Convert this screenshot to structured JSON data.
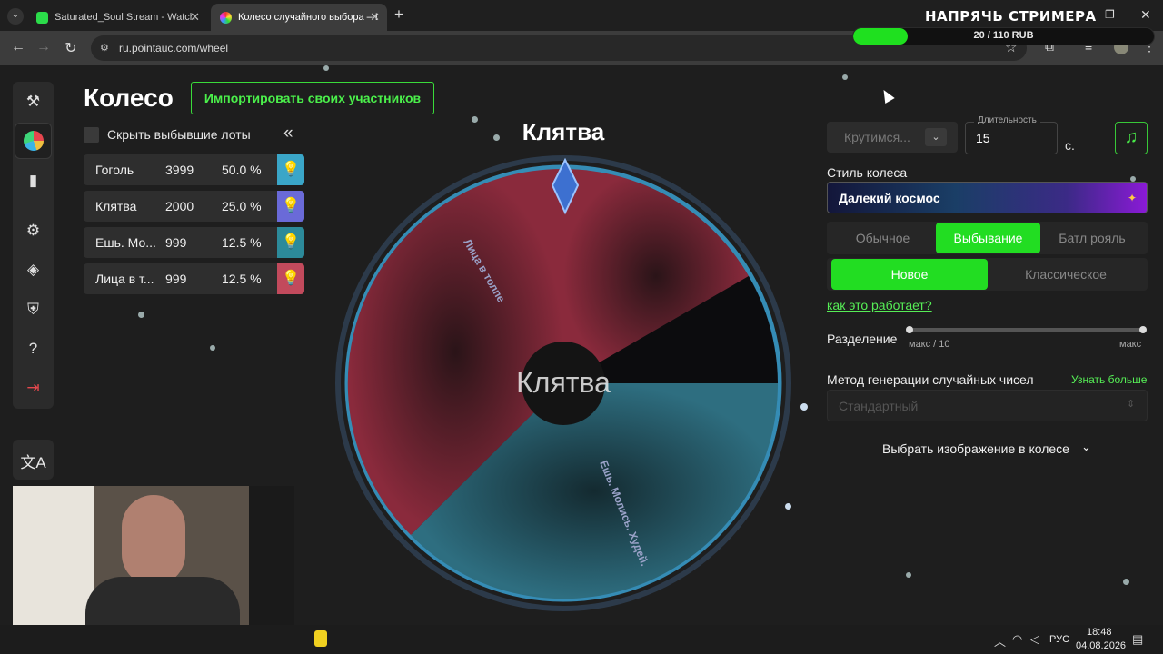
{
  "browser": {
    "tabs": [
      {
        "title": "Saturated_Soul Stream - Watch",
        "close": "✕"
      },
      {
        "title": "Колесо случайного выбора – I",
        "close": "✕"
      }
    ],
    "new_tab": "+",
    "url": "ru.pointauc.com/wheel",
    "window_controls": {
      "minimize": "—",
      "maximize": "❐",
      "close": "✕"
    }
  },
  "overlay": {
    "goal_title": "НАПРЯЧЬ СТРИМЕРА",
    "goal_text": "20 / 110 RUB",
    "goal_progress": 0.18,
    "goal_color": "#1fe01f"
  },
  "sidebar": {
    "items": [
      {
        "icon": "gavel-icon"
      },
      {
        "icon": "wheel-icon"
      },
      {
        "icon": "bar-chart-icon"
      },
      {
        "icon": "gear-icon"
      },
      {
        "icon": "layers-icon"
      },
      {
        "icon": "shield-check-icon"
      },
      {
        "icon": "help-icon"
      },
      {
        "icon": "logout-icon"
      }
    ],
    "lang_icon": "translate-icon"
  },
  "header": {
    "title": "Колесо",
    "import_button": "Импортировать своих участников",
    "hide_label": "Скрыть выбывшие лоты",
    "collapse": "«"
  },
  "lots": [
    {
      "name": "Гоголь",
      "value": "3999",
      "percent": "50.0 %",
      "color": "#3aa6c8"
    },
    {
      "name": "Клятва",
      "value": "2000",
      "percent": "25.0 %",
      "color": "#6a6ad8"
    },
    {
      "name": "Ешь. Мо...",
      "value": "999",
      "percent": "12.5 %",
      "color": "#2c8a9a"
    },
    {
      "name": "Лица в т...",
      "value": "999",
      "percent": "12.5 %",
      "color": "#c24a5c"
    }
  ],
  "wheel": {
    "winner": "Клятва",
    "center_text": "Клятва",
    "segment_labels": [
      "Лица в толпе",
      "Ешь. Молись. Худей."
    ]
  },
  "controls": {
    "spin_button": "Крутимся...",
    "duration_label": "Длительность",
    "duration_value": "15",
    "duration_unit": "с.",
    "style_label": "Стиль колеса",
    "style_value": "Далекий космос",
    "modes": [
      "Обычное",
      "Выбывание",
      "Батл рояль"
    ],
    "active_mode": "Выбывание",
    "sub_modes": [
      "Новое",
      "Классическое"
    ],
    "active_sub_mode": "Новое",
    "how_link": "как это работает?",
    "split_label": "Разделение",
    "split_min": "макс / 10",
    "split_max": "макс",
    "rng_label": "Метод генерации случайных чисел",
    "rng_link": "Узнать больше",
    "rng_value": "Стандартный",
    "image_pick": "Выбрать изображение в колесе",
    "accent": "#22dd22"
  },
  "taskbar": {
    "lang": "РУС",
    "time": "18:48",
    "date": "04.08.2026"
  }
}
